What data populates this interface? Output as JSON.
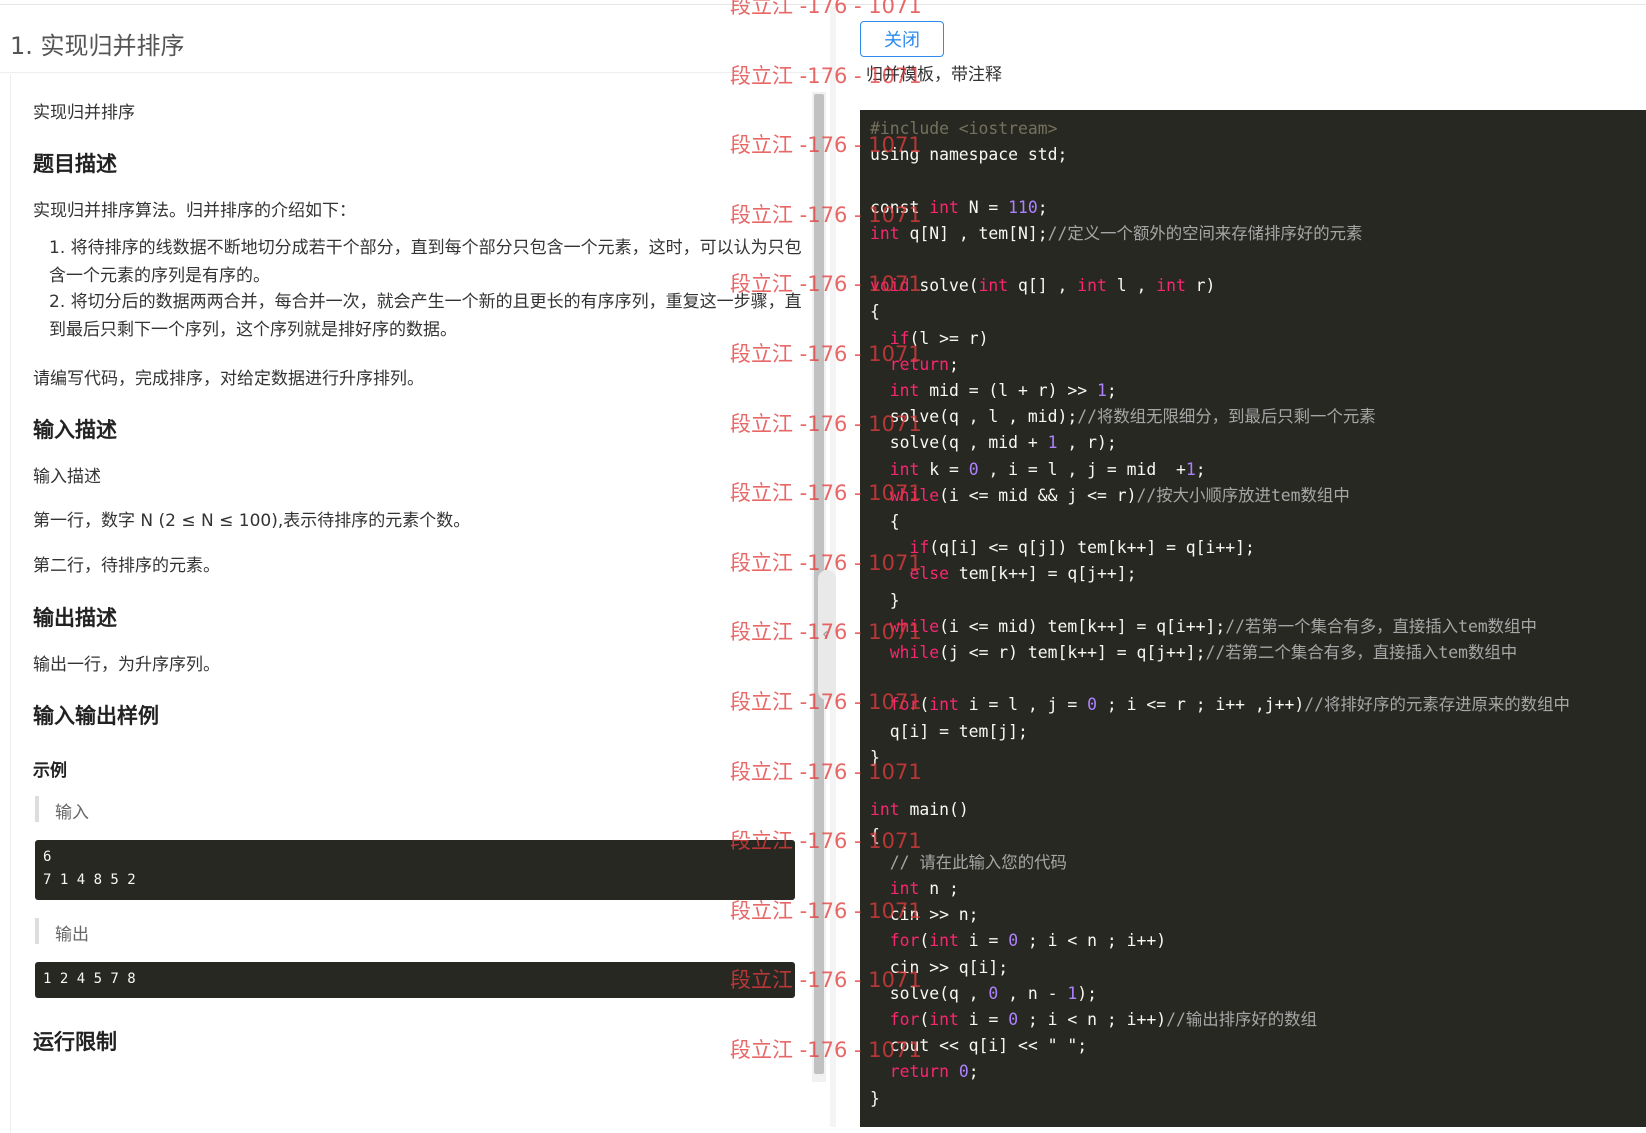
{
  "problem": {
    "title": "1. 实现归并排序",
    "intro": "实现归并排序",
    "desc_heading": "题目描述",
    "desc": "实现归并排序算法。归并排序的介绍如下：",
    "steps": [
      "1. 将待排序的线数据不断地切分成若干个部分，直到每个部分只包含一个元素，这时，可以认为只包含一个元素的序列是有序的。",
      "2. 将切分后的数据两两合并，每合并一次，就会产生一个新的且更长的有序序列，重复这一步骤，直到最后只剩下一个序列，这个序列就是排好序的数据。"
    ],
    "task": "请编写代码，完成排序，对给定数据进行升序排列。",
    "input_heading": "输入描述",
    "input_desc": "输入描述",
    "input_line1": "第一行，数字 N (2 ≤ N ≤ 100),表示待排序的元素个数。",
    "input_line2": "第二行，待排序的元素。",
    "output_heading": "输出描述",
    "output_desc": "输出一行，为升序序列。",
    "sample_heading": "输入输出样例",
    "example_label": "示例",
    "input_label": "输入",
    "sample_input": "6\n7 1 4 8 5 2",
    "output_label": "输出",
    "sample_output": "1 2 4 5 7 8",
    "limits_heading": "运行限制"
  },
  "solution": {
    "close_label": "关闭",
    "note": "归并模板，带注释",
    "code_lines": [
      "#include <iostream>",
      "using namespace std;",
      "",
      "const int N = 110;",
      "int q[N] , tem[N];//定义一个额外的空间来存储排序好的元素",
      "",
      "void solve(int q[] , int l , int r)",
      "{",
      "  if(l >= r)",
      "  return;",
      "  int mid = (l + r) >> 1;",
      "  solve(q , l , mid);//将数组无限细分，到最后只剩一个元素",
      "  solve(q , mid + 1 , r);",
      "  int k = 0 , i = l , j = mid  +1;",
      "  while(i <= mid && j <= r)//按大小顺序放进tem数组中",
      "  {",
      "    if(q[i] <= q[j]) tem[k++] = q[i++];",
      "    else tem[k++] = q[j++];",
      "  }",
      "  while(i <= mid) tem[k++] = q[i++];//若第一个集合有多，直接插入tem数组中",
      "  while(j <= r) tem[k++] = q[j++];//若第二个集合有多，直接插入tem数组中",
      "",
      "  for(int i = l , j = 0 ; i <= r ; i++ ,j++)//将排好序的元素存进原来的数组中",
      "  q[i] = tem[j];",
      "}",
      "",
      "int main()",
      "{",
      "  // 请在此输入您的代码",
      "  int n ;",
      "  cin >> n;",
      "  for(int i = 0 ; i < n ; i++)",
      "  cin >> q[i];",
      "  solve(q , 0 , n - 1);",
      "  for(int i = 0 ; i < n ; i++)//输出排序好的数组",
      "  cout << q[i] << \" \";",
      "  return 0;",
      "}"
    ]
  },
  "watermark": "段立江 -176 - 1071",
  "colors": {
    "code_bg": "#272822",
    "keyword": "#f92672",
    "number": "#ae81ff",
    "button_accent": "#2d8cf0",
    "watermark": "#e23c3c"
  }
}
